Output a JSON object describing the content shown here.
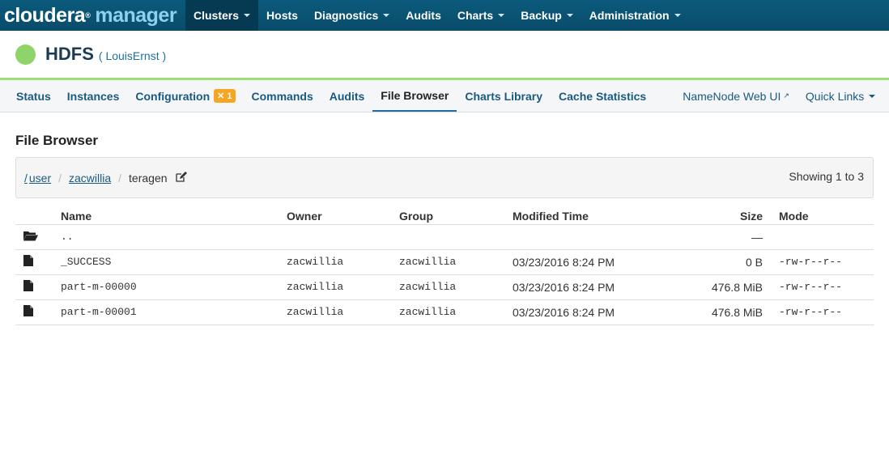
{
  "brand": {
    "part1": "cloudera",
    "part2": "manager",
    "reg": "®"
  },
  "topnav": [
    {
      "label": "Clusters",
      "dropdown": true,
      "active": true
    },
    {
      "label": "Hosts",
      "dropdown": false
    },
    {
      "label": "Diagnostics",
      "dropdown": true
    },
    {
      "label": "Audits",
      "dropdown": false
    },
    {
      "label": "Charts",
      "dropdown": true
    },
    {
      "label": "Backup",
      "dropdown": true
    },
    {
      "label": "Administration",
      "dropdown": true
    }
  ],
  "service": {
    "name": "HDFS",
    "cluster": "( LouisErnst )",
    "status_color": "#8fd46b"
  },
  "tabs": {
    "status": "Status",
    "instances": "Instances",
    "configuration": "Configuration",
    "config_issues": "1",
    "commands": "Commands",
    "audits": "Audits",
    "file_browser": "File Browser",
    "charts_library": "Charts Library",
    "cache_statistics": "Cache Statistics",
    "namenode_web_ui": "NameNode Web UI",
    "quick_links": "Quick Links"
  },
  "page_title": "File Browser",
  "breadcrumb": {
    "root": "/",
    "user": "user",
    "zacwillia": "zacwillia",
    "current": "teragen",
    "sep": "/"
  },
  "showing": "Showing 1 to 3",
  "table": {
    "headers": {
      "name": "Name",
      "owner": "Owner",
      "group": "Group",
      "modified": "Modified Time",
      "size": "Size",
      "mode": "Mode"
    },
    "parent": {
      "name": "..",
      "size": "—"
    },
    "rows": [
      {
        "name": "_SUCCESS",
        "owner": "zacwillia",
        "group": "zacwillia",
        "modified": "03/23/2016 8:24 PM",
        "size": "0 B",
        "mode": "-rw-r--r--"
      },
      {
        "name": "part-m-00000",
        "owner": "zacwillia",
        "group": "zacwillia",
        "modified": "03/23/2016 8:24 PM",
        "size": "476.8 MiB",
        "mode": "-rw-r--r--"
      },
      {
        "name": "part-m-00001",
        "owner": "zacwillia",
        "group": "zacwillia",
        "modified": "03/23/2016 8:24 PM",
        "size": "476.8 MiB",
        "mode": "-rw-r--r--"
      }
    ]
  },
  "icons": {
    "folder": "folder-open-icon",
    "file": "file-icon",
    "edit": "edit-icon",
    "external": "external-link-icon"
  },
  "colors": {
    "navbar": "#0b5a7c",
    "brand_accent": "#8fd0f0",
    "link": "#1a5a80",
    "config_badge": "#f5a623",
    "health_good": "#9edc75"
  }
}
